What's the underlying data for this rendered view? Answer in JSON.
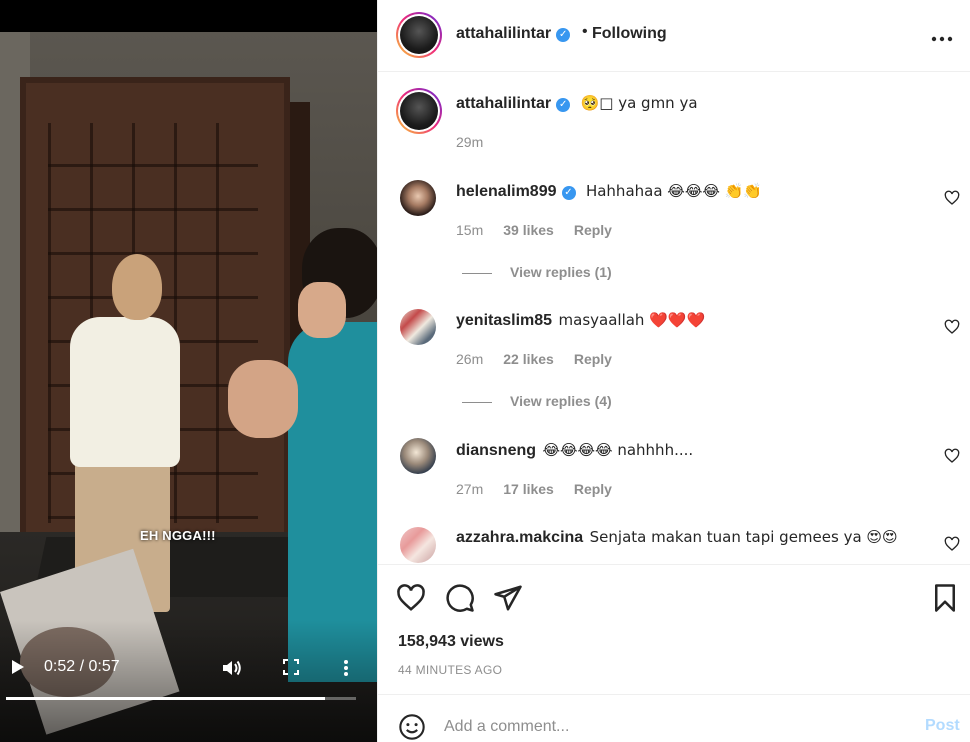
{
  "video": {
    "caption_overlay": "EH NGGA!!!",
    "time_readout": "0:52 / 0:57",
    "progress_fraction": 0.91
  },
  "header": {
    "username": "attahalilintar",
    "verified": true,
    "separator": "•",
    "follow_status": "Following",
    "more_icon": "more-horizontal-icon"
  },
  "caption": {
    "username": "attahalilintar",
    "text": "🥺□ ya gmn ya",
    "time": "29m"
  },
  "comments": [
    {
      "username": "helenalim899",
      "verified": true,
      "text": "Hahhahaa 😂😂😂 👏👏",
      "time": "15m",
      "likes": "39 likes",
      "reply": "Reply",
      "view_replies": "View replies (1)"
    },
    {
      "username": "yenitaslim85",
      "verified": false,
      "text": "masyaallah ❤️❤️❤️",
      "time": "26m",
      "likes": "22 likes",
      "reply": "Reply",
      "view_replies": "View replies (4)"
    },
    {
      "username": "diansneng",
      "verified": false,
      "text": "😂😂😂😂 nahhhh....",
      "time": "27m",
      "likes": "17 likes",
      "reply": "Reply"
    },
    {
      "username": "azzahra.makcina",
      "verified": false,
      "text": "Senjata makan tuan tapi gemees ya 😍😍"
    }
  ],
  "actions": {
    "icons": [
      "heart-icon",
      "comment-icon",
      "share-icon",
      "bookmark-icon"
    ],
    "views": "158,943 views",
    "time_ago": "44 MINUTES AGO"
  },
  "add_comment": {
    "placeholder": "Add a comment...",
    "post_label": "Post"
  },
  "colors": {
    "verified_blue": "#3897f0",
    "post_disabled": "#b3dbff",
    "muted_text": "#8e8e8e",
    "video_shirt_teal": "#1f8f9d"
  }
}
